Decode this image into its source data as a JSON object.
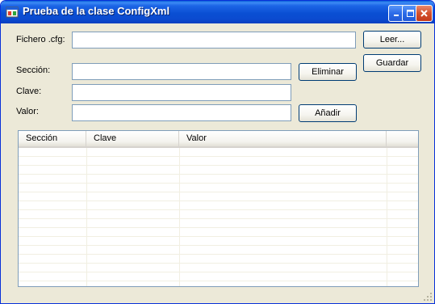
{
  "window": {
    "title": "Prueba de la clase ConfigXml"
  },
  "form": {
    "fichero_label": "Fichero .cfg:",
    "fichero_value": "",
    "seccion_label": "Sección:",
    "seccion_value": "",
    "clave_label": "Clave:",
    "clave_value": "",
    "valor_label": "Valor:",
    "valor_value": "",
    "leer_label": "Leer...",
    "guardar_label": "Guardar",
    "eliminar_label": "Eliminar",
    "anadir_label": "Añadir"
  },
  "listview": {
    "columns": [
      "Sección",
      "Clave",
      "Valor"
    ],
    "rows": []
  },
  "colors": {
    "titlebar": "#0a4fd3",
    "window_bg": "#ece9d8",
    "button_border": "#003c74",
    "textbox_border": "#7f9db9"
  },
  "icons": [
    "app-window-icon",
    "minimize-icon",
    "maximize-icon",
    "close-icon"
  ]
}
